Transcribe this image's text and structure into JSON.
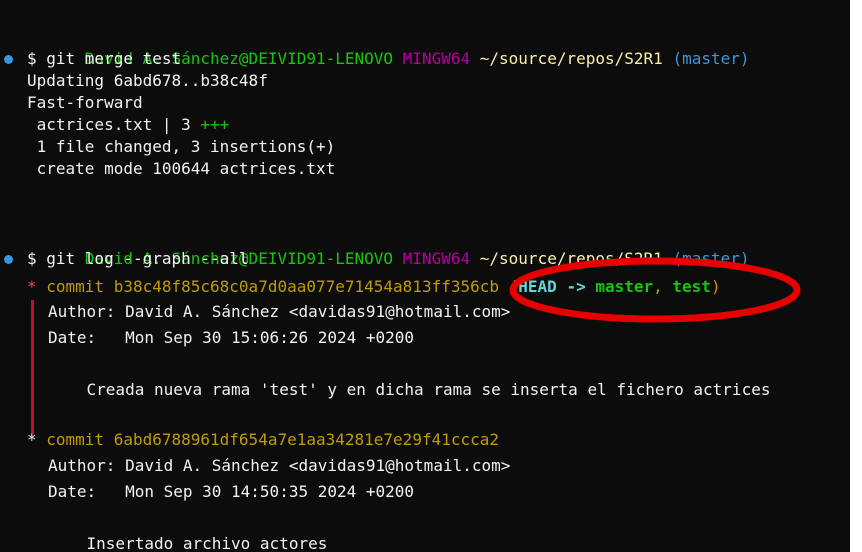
{
  "prompt": {
    "user_host": "David A. Sánchez@DEIVID91-LENOVO",
    "shell": "MINGW64",
    "path": "~/source/repos/S2R1",
    "branch": "(master)"
  },
  "cmd1": {
    "text": "$ git merge test"
  },
  "merge_output": {
    "l1": "Updating 6abd678..b38c48f",
    "l2": "Fast-forward",
    "l3_file": " actrices.txt | 3 ",
    "l3_plus": "+++",
    "l4": " 1 file changed, 3 insertions(+)",
    "l5": " create mode 100644 actrices.txt"
  },
  "cmd2": {
    "text": "$ git log --graph --all"
  },
  "commit1": {
    "star": "* ",
    "commit_label": "commit b38c48f85c68c0a7d0aa077e71454a813ff356",
    "hidden_tail": "cb",
    "paren_open": " (",
    "head": "HEAD -> ",
    "master": "master",
    "comma": ", ",
    "test": "test",
    "paren_close": ")",
    "author": "Author: David A. Sánchez <davidas91@hotmail.com>",
    "date": "Date:   Mon Sep 30 15:06:26 2024 +0200",
    "message": "    Creada nueva rama 'test' y en dicha rama se inserta el fichero actrices"
  },
  "commit2": {
    "star": "* ",
    "commit_label": "commit 6abd6788961df654a7e1aa34281e7e29f41ccca2",
    "author": "Author: David A. Sánchez <davidas91@hotmail.com>",
    "date": "Date:   Mon Sep 30 14:50:35 2024 +0200",
    "message": "    Insertado archivo actores"
  },
  "colors": {
    "background": "#0c0c0c",
    "foreground": "#f2f2f2",
    "prompt_green": "#16c60c",
    "prompt_magenta": "#b4009e",
    "path_yellow": "#f9f1a5",
    "branch_cyan": "#3a96dd",
    "commit_yellow": "#c19c00",
    "head_cyan": "#61d6d6",
    "annotation_red": "#e60000"
  }
}
